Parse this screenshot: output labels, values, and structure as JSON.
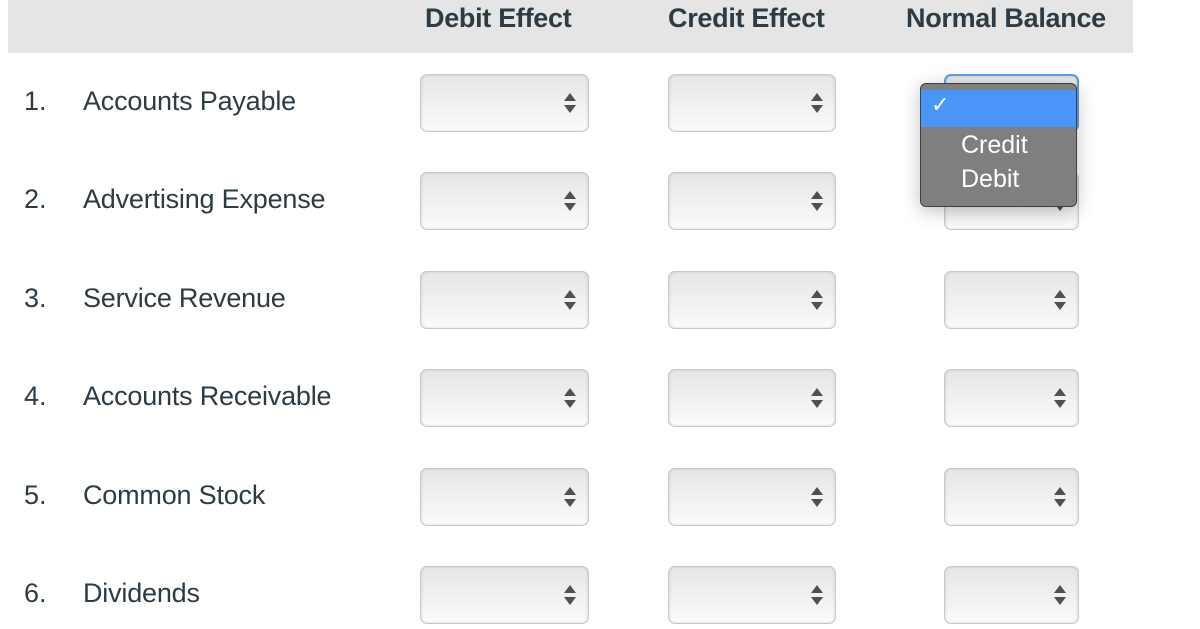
{
  "header": {
    "columns": [
      "Debit Effect",
      "Credit Effect",
      "Normal Balance"
    ]
  },
  "colors": {
    "header_bg": "#e5e5e5",
    "text": "#2d3b45",
    "focus_border": "#5aa0e6",
    "dropdown_bg": "#7f7f7f",
    "dropdown_selected": "#4a96f8"
  },
  "rows": [
    {
      "number": "1.",
      "label": "Accounts Payable",
      "debit_effect": "",
      "credit_effect": "",
      "normal_balance": ""
    },
    {
      "number": "2.",
      "label": "Advertising Expense",
      "debit_effect": "",
      "credit_effect": "",
      "normal_balance": ""
    },
    {
      "number": "3.",
      "label": "Service Revenue",
      "debit_effect": "",
      "credit_effect": "",
      "normal_balance": ""
    },
    {
      "number": "4.",
      "label": "Accounts Receivable",
      "debit_effect": "",
      "credit_effect": "",
      "normal_balance": ""
    },
    {
      "number": "5.",
      "label": "Common Stock",
      "debit_effect": "",
      "credit_effect": "",
      "normal_balance": ""
    },
    {
      "number": "6.",
      "label": "Dividends",
      "debit_effect": "",
      "credit_effect": "",
      "normal_balance": ""
    }
  ],
  "open_dropdown": {
    "row": 1,
    "column": "Normal Balance",
    "check_icon": "checkmark-icon",
    "options": [
      "",
      "Credit",
      "Debit"
    ],
    "selected_index": 0
  },
  "icons": {
    "select_arrows": "up-down-arrows-icon"
  }
}
